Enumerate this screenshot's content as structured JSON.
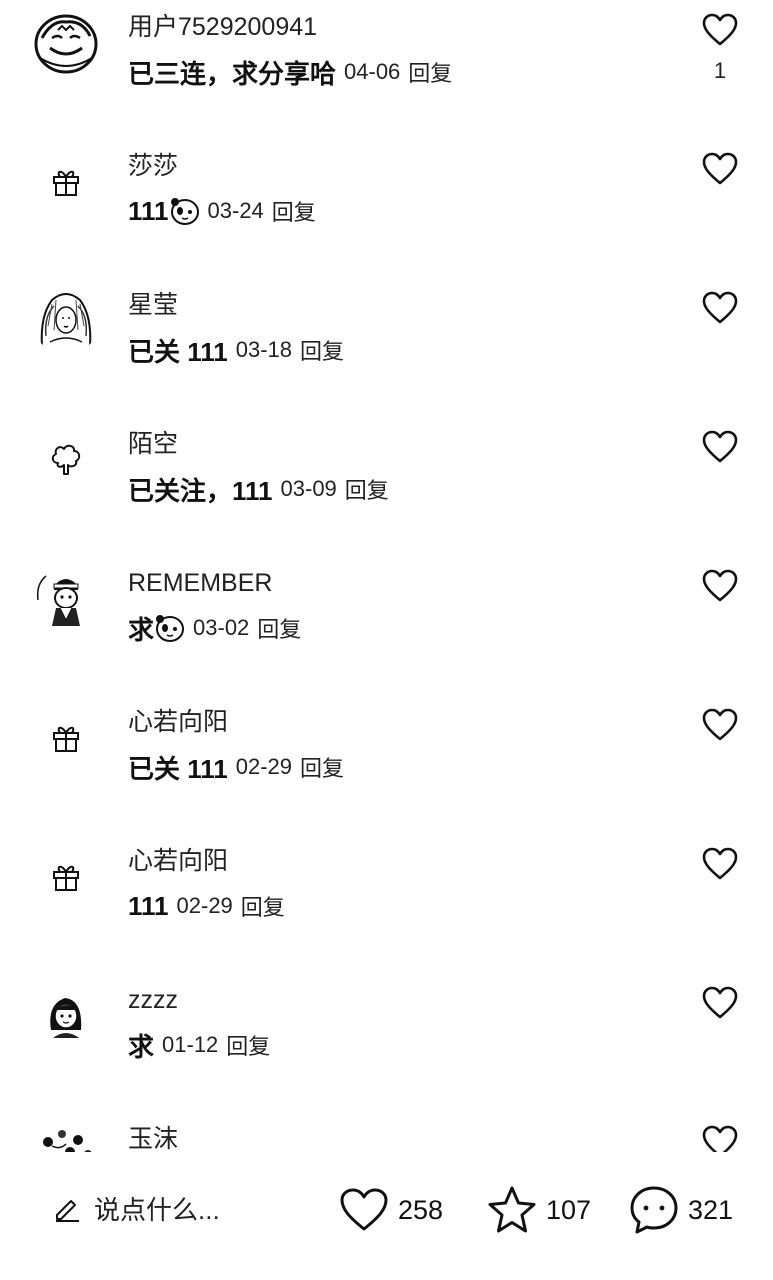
{
  "comments": [
    {
      "name": "用户7529200941",
      "text": "已三连，求分享哈",
      "emoji": false,
      "date": "04-06",
      "reply": "回复",
      "likes": "1",
      "avatar": "face-sketch-avatar"
    },
    {
      "name": "莎莎",
      "text": "111",
      "emoji": true,
      "date": "03-24",
      "reply": "回复",
      "likes": "",
      "avatar": "gift-icon"
    },
    {
      "name": "星莹",
      "text": "已关 111",
      "emoji": false,
      "date": "03-18",
      "reply": "回复",
      "likes": "",
      "avatar": "girl-sketch-avatar"
    },
    {
      "name": "陌空",
      "text": "已关注，111",
      "emoji": false,
      "date": "03-09",
      "reply": "回复",
      "likes": "",
      "avatar": "tree-icon"
    },
    {
      "name": "REMEMBER",
      "text": "求",
      "emoji": true,
      "date": "03-02",
      "reply": "回复",
      "likes": "",
      "avatar": "boy-cartoon-avatar"
    },
    {
      "name": "心若向阳",
      "text": "已关 111",
      "emoji": false,
      "date": "02-29",
      "reply": "回复",
      "likes": "",
      "avatar": "gift-icon"
    },
    {
      "name": "心若向阳",
      "text": "111",
      "emoji": false,
      "date": "02-29",
      "reply": "回复",
      "likes": "",
      "avatar": "gift-icon"
    },
    {
      "name": "zzzz",
      "text": "求",
      "emoji": false,
      "date": "01-12",
      "reply": "回复",
      "likes": "",
      "avatar": "girl-cartoon-avatar"
    },
    {
      "name": "玉沫",
      "text": "",
      "emoji": false,
      "date": "",
      "reply": "",
      "likes": "",
      "avatar": "flower-pattern-avatar"
    }
  ],
  "bottom_bar": {
    "input_placeholder": "说点什么...",
    "likes": "258",
    "favorites": "107",
    "comments": "321"
  }
}
